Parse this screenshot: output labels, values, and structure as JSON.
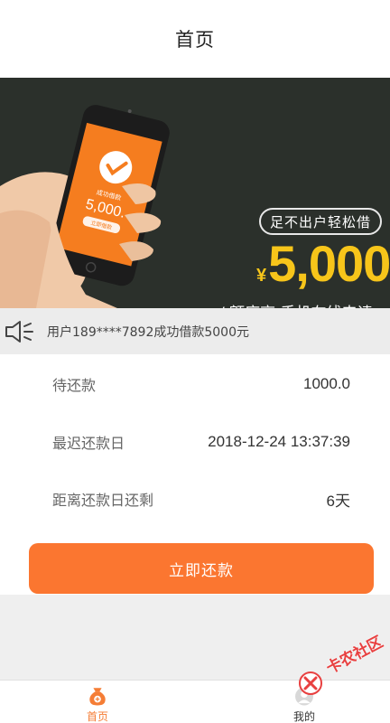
{
  "header": {
    "title": "首页"
  },
  "banner": {
    "pill_text": "足不出户轻松借",
    "currency": "¥",
    "amount": "5,000",
    "slogan": "/ 额度高,手机在线申请",
    "phone_screen": {
      "label": "成功借款",
      "amount": "5,000.",
      "button": "立即借款"
    },
    "colors": {
      "background": "#2b302b",
      "amount": "#f7c51a",
      "phone_screen": "#f57d1f"
    }
  },
  "notice": {
    "icon": "speaker-icon",
    "text": "用户189****7892成功借款5000元"
  },
  "info": {
    "rows": [
      {
        "label": "待还款",
        "value": "1000.0"
      },
      {
        "label": "最迟还款日",
        "value": "2018-12-24 13:37:39"
      },
      {
        "label": "距离还款日还剩",
        "value": "6天"
      }
    ]
  },
  "repay_button": {
    "label": "立即还款",
    "color": "#fb7630"
  },
  "tabbar": {
    "tabs": [
      {
        "label": "首页",
        "icon": "money-bag-icon",
        "active": true
      },
      {
        "label": "我的",
        "icon": "user-icon",
        "active": false
      }
    ]
  },
  "watermark": {
    "text": "卡农社区"
  }
}
